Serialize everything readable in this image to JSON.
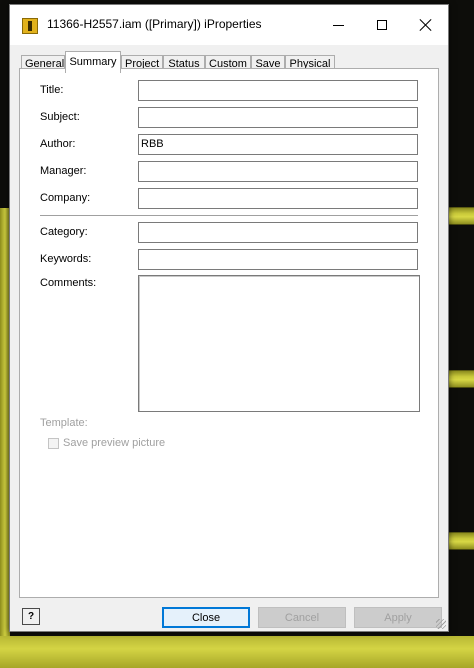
{
  "window": {
    "title": "11366-H2557.iam ([Primary]) iProperties",
    "icon": "inventor-assembly-icon"
  },
  "tabs": [
    {
      "label": "General"
    },
    {
      "label": "Summary",
      "active": true
    },
    {
      "label": "Project"
    },
    {
      "label": "Status"
    },
    {
      "label": "Custom"
    },
    {
      "label": "Save"
    },
    {
      "label": "Physical"
    }
  ],
  "summary": {
    "title": {
      "label": "Title:",
      "value": ""
    },
    "subject": {
      "label": "Subject:",
      "value": ""
    },
    "author": {
      "label": "Author:",
      "value": "RBB"
    },
    "manager": {
      "label": "Manager:",
      "value": ""
    },
    "company": {
      "label": "Company:",
      "value": ""
    },
    "category": {
      "label": "Category:",
      "value": ""
    },
    "keywords": {
      "label": "Keywords:",
      "value": ""
    },
    "comments": {
      "label": "Comments:",
      "value": ""
    },
    "template": {
      "label": "Template:"
    },
    "save_preview": {
      "label": "Save preview picture",
      "checked": false
    }
  },
  "buttons": {
    "close": "Close",
    "cancel": "Cancel",
    "apply": "Apply",
    "help": "?"
  },
  "colors": {
    "accent": "#0078d7",
    "background_cad": "#c9c93a"
  }
}
